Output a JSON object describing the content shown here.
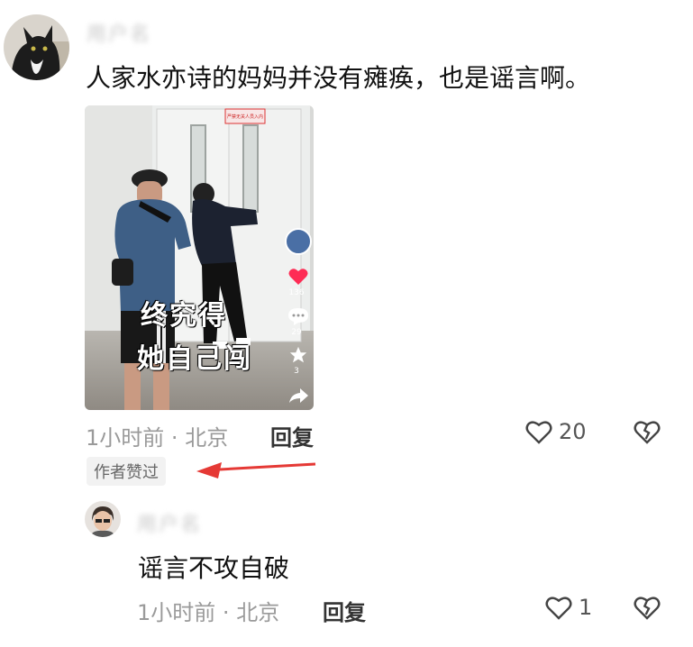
{
  "comment": {
    "username": "用户名",
    "text": "人家水亦诗的妈妈并没有瘫痪，也是谣言啊。",
    "time": "1小时前",
    "separator": "·",
    "location": "北京",
    "reply_label": "回复",
    "like_count": "20",
    "author_badge": "作者赞过",
    "video": {
      "overlay_line1": "终究得",
      "overlay_line2": "她自己闯",
      "like_count": "136",
      "comment_count": "29",
      "fav_count": "3",
      "sign_text": "严禁无关人员入内"
    }
  },
  "reply": {
    "username": "用户名",
    "text": "谣言不攻自破",
    "time": "1小时前",
    "separator": "·",
    "location": "北京",
    "reply_label": "回复",
    "like_count": "1"
  },
  "colors": {
    "arrow": "#e53935",
    "heart_red": "#fe2c55"
  },
  "icons": [
    "heart-outline-icon",
    "broken-heart-icon",
    "heart-icon",
    "comment-bubble-icon",
    "star-icon",
    "share-arrow-icon"
  ]
}
